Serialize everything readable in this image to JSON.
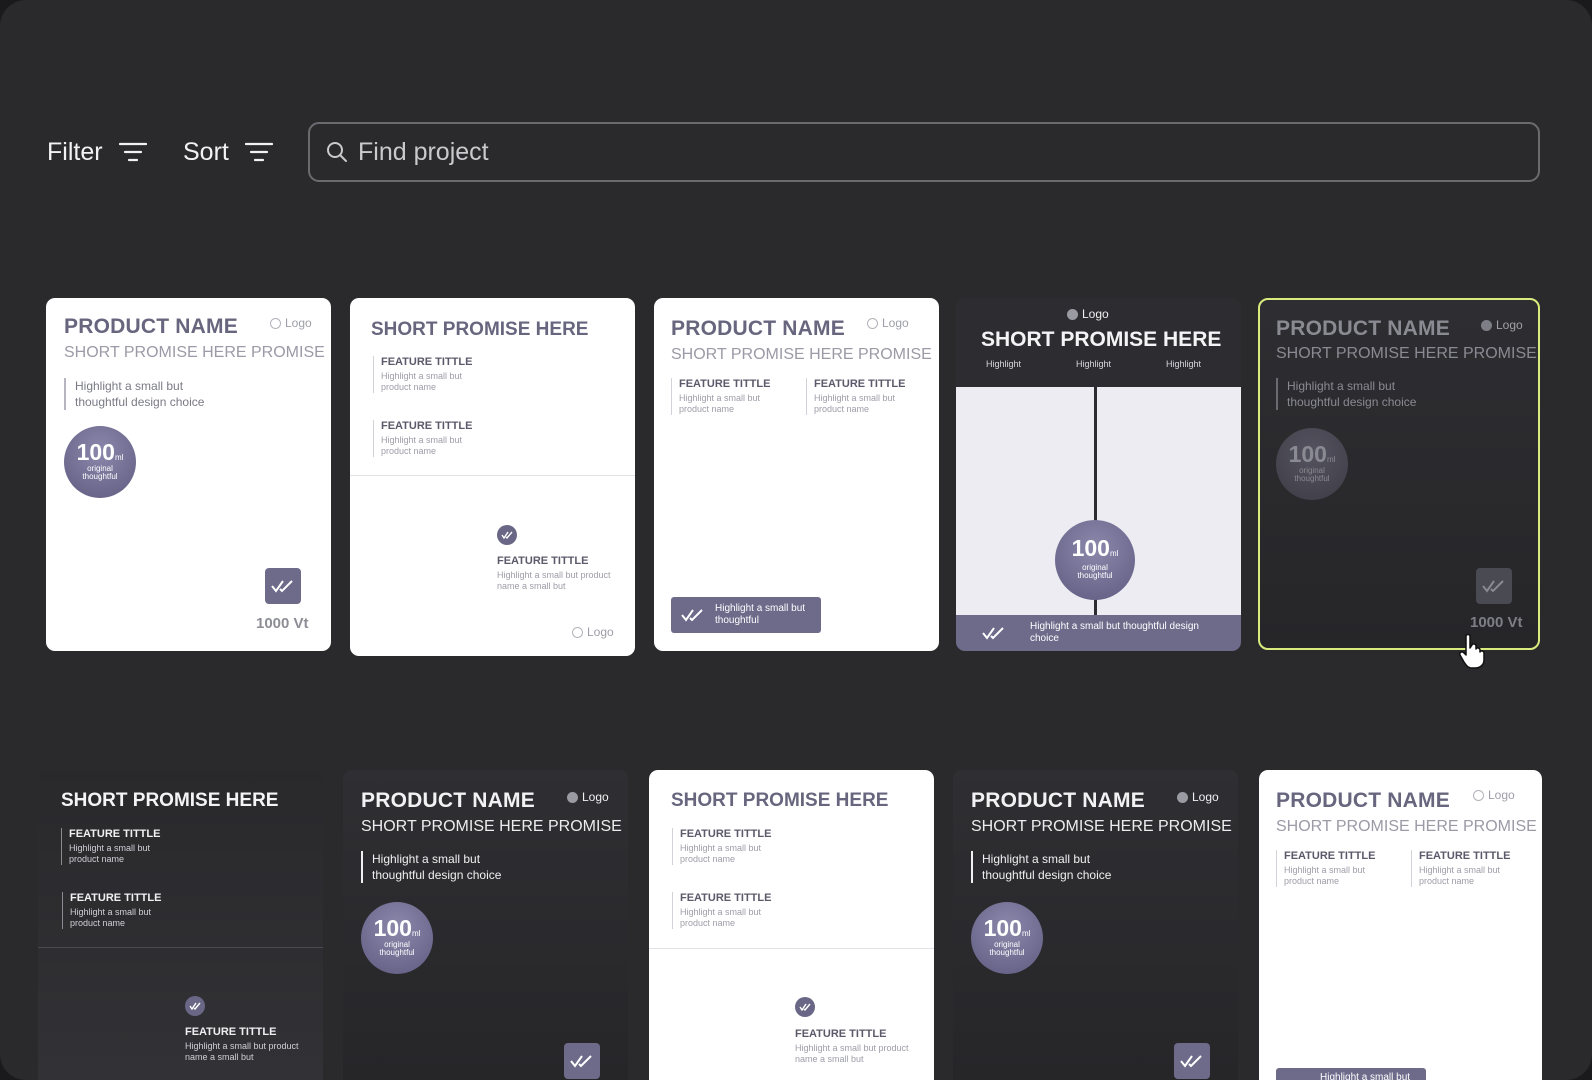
{
  "toolbar": {
    "filter_label": "Filter",
    "sort_label": "Sort",
    "search_placeholder": "Find project"
  },
  "card_text": {
    "product_name": "PRODUCT NAME",
    "short_promise_here": "SHORT PROMISE HERE",
    "short_promise_here_promise": "SHORT PROMISE HERE PROMISE",
    "highlight_line1": "Highlight a small but",
    "highlight_line2": "thoughtful design choice",
    "logo": "Logo",
    "volume": "100",
    "unit": "ml",
    "badge_line1": "original",
    "badge_line2": "thoughtful",
    "price": "1000 Vt",
    "feature_title": "FEATURE TITTLE",
    "feature_desc_line1": "Highlight a small but",
    "feature_desc_line2": "product name",
    "feature_desc_wide_line1": "Highlight a small but  product",
    "feature_desc_wide_line2": "name a small but",
    "highlight": "Highlight",
    "pill_line1": "Highlight a small but",
    "pill_line2": "thoughtful",
    "banner_line1": "Highlight a small but thoughtful design",
    "banner_line2": "choice"
  }
}
